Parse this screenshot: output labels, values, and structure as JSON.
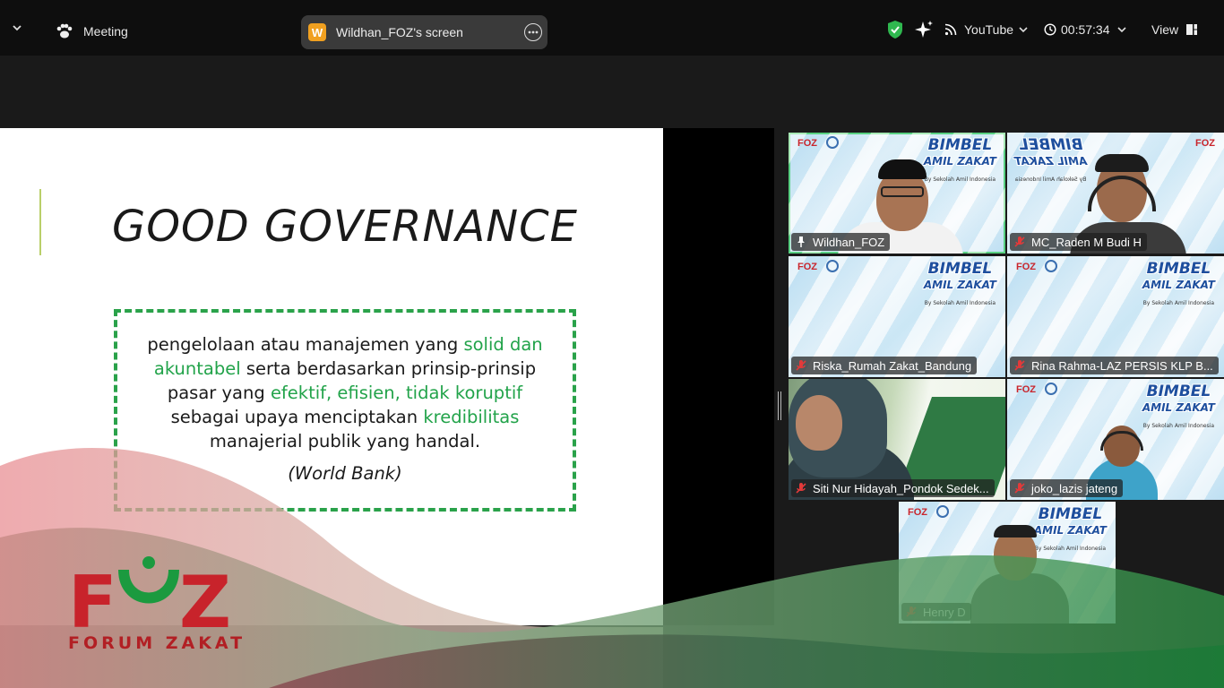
{
  "topbar": {
    "meeting_label": "Meeting",
    "screen_badge_letter": "W",
    "screen_title": "Wildhan_FOZ's screen",
    "stream_label": "YouTube",
    "timer": "00:57:34",
    "view_label": "View"
  },
  "slide": {
    "title": "GOOD GOVERNANCE",
    "quote": {
      "line1_plain": "pengelolaan atau manajemen yang ",
      "line1_green": "solid dan",
      "line2_green": "akuntabel",
      "line2_plain": " serta berdasarkan prinsip-prinsip",
      "line3_plain": "pasar yang ",
      "line3_green": "efektif, efisien, tidak koruptif",
      "line4_plain": "sebagai upaya menciptakan ",
      "line4_green": "kredibilitas",
      "line5_plain": "manajerial publik yang handal.",
      "source": "(World Bank)"
    }
  },
  "banner": {
    "title1": "BIMBEL",
    "title2": "AMIL ZAKAT",
    "subtitle": "By Sekolah Amil Indonesia",
    "logo": "FOZ"
  },
  "participants": [
    {
      "name": "Wildhan_FOZ",
      "muted": false,
      "pinned": true,
      "active": true
    },
    {
      "name": "MC_Raden M Budi H",
      "muted": true
    },
    {
      "name": "Riska_Rumah Zakat_Bandung",
      "muted": true
    },
    {
      "name": "Rina Rahma-LAZ PERSIS KLP B...",
      "muted": true
    },
    {
      "name": "Siti Nur Hidayah_Pondok Sedek...",
      "muted": true
    },
    {
      "name": "joko_lazis jateng",
      "muted": true
    },
    {
      "name": "Henry D",
      "muted": true
    }
  ],
  "overlay": {
    "logo_text": "FOZ",
    "logo_sub": "FORUM ZAKAT"
  },
  "colors": {
    "accent_green": "#22a34a",
    "active_border": "#3ecf5e",
    "shield": "#2fb84f",
    "logo_red": "#c8232b"
  }
}
